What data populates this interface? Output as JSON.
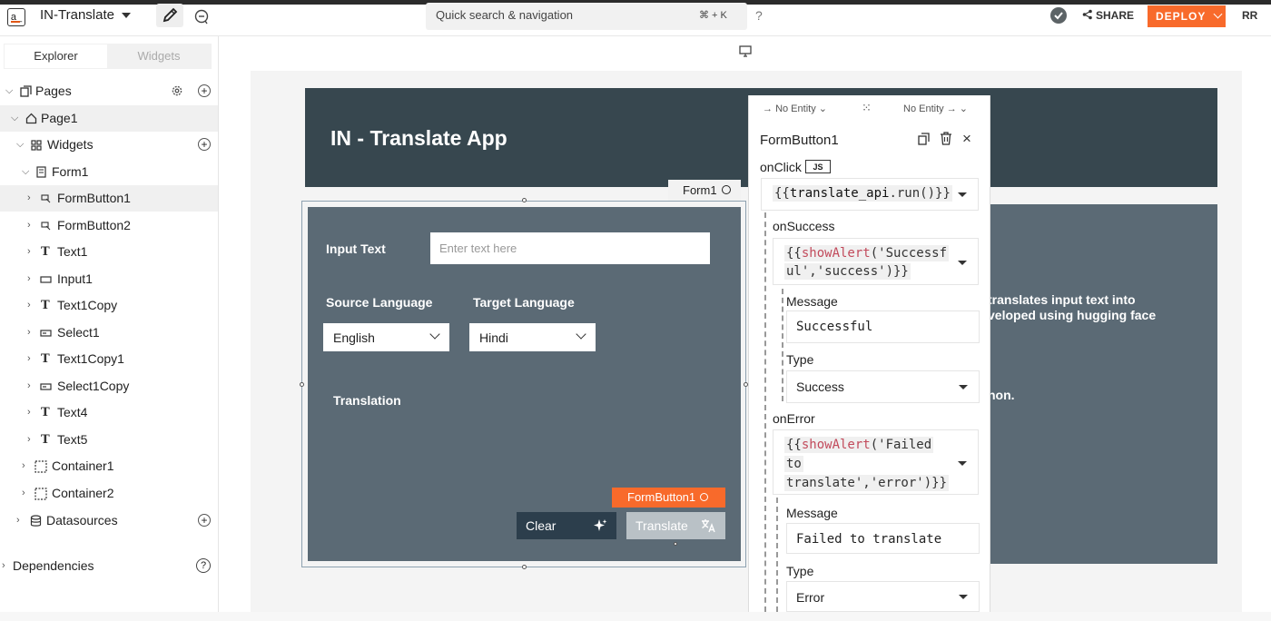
{
  "topbar": {
    "logo": "a_",
    "app_name": "IN-Translate",
    "search_label": "Quick search & navigation",
    "search_shortcut": "⌘ + K",
    "help": "?",
    "share_label": "SHARE",
    "deploy_label": "DEPLOY",
    "user_initials": "RR"
  },
  "sidebar": {
    "tabs": [
      "Explorer",
      "Widgets"
    ],
    "pages_label": "Pages",
    "items": [
      {
        "label": "Page1"
      },
      {
        "label": "Widgets"
      },
      {
        "label": "Form1"
      },
      {
        "label": "FormButton1"
      },
      {
        "label": "FormButton2"
      },
      {
        "label": "Text1"
      },
      {
        "label": "Input1"
      },
      {
        "label": "Text1Copy"
      },
      {
        "label": "Select1"
      },
      {
        "label": "Text1Copy1"
      },
      {
        "label": "Select1Copy"
      },
      {
        "label": "Text4"
      },
      {
        "label": "Text5"
      },
      {
        "label": "Container1"
      },
      {
        "label": "Container2"
      },
      {
        "label": "Datasources"
      }
    ],
    "dependencies_label": "Dependencies"
  },
  "canvas": {
    "app_title": "IN - Translate App",
    "right_text": [
      "translates input text into",
      "veloped using hugging face",
      "hon."
    ],
    "form_tag": "Form1",
    "input_text_label": "Input Text",
    "input_placeholder": "Enter text here",
    "source_language_label": "Source Language",
    "target_language_label": "Target Language",
    "source_language_value": "English",
    "target_language_value": "Hindi",
    "translation_label": "Translation",
    "formbutton_tag": "FormButton1",
    "clear_label": "Clear",
    "translate_label": "Translate"
  },
  "panel": {
    "entity_left": "No Entity",
    "entity_right": "No Entity",
    "title": "FormButton1",
    "onclick_label": "onClick",
    "js_badge": "JS",
    "onclick_code_open": "{{",
    "onclick_code_fn": "translate_api",
    "onclick_code_rest": ".run()}}",
    "onsuccess_label": "onSuccess",
    "onsuccess_code_line1_a": "{{",
    "onsuccess_code_line1_fn": "showAlert",
    "onsuccess_code_line1_b": "('Successf",
    "onsuccess_code_line2": "ul','success')}}",
    "message_label": "Message",
    "success_message_value": "Successful",
    "type_label": "Type",
    "success_type_value": "Success",
    "onerror_label": "onError",
    "onerror_code_line1_a": "{{",
    "onerror_code_line1_fn": "showAlert",
    "onerror_code_line1_b": "('Failed",
    "onerror_code_line2": "to",
    "onerror_code_line3": "translate','error')}}",
    "error_message_value": "Failed to translate",
    "error_type_value": "Error"
  },
  "colors": {
    "accent": "#f86a2b",
    "header_bg": "#37474f",
    "form_bg": "#5b6a75",
    "clear_btn": "#2c3e4c"
  }
}
